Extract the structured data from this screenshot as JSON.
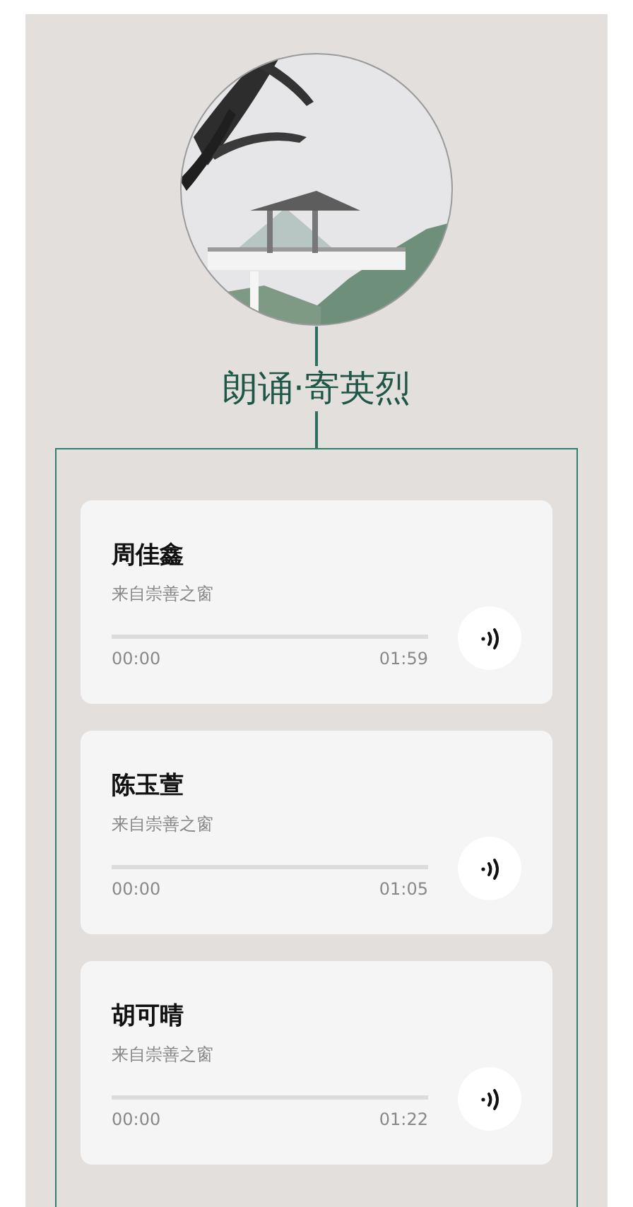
{
  "title": "朗诵·寄英烈",
  "recordings": [
    {
      "name": "周佳鑫",
      "source": "来自崇善之窗",
      "level": 0,
      "current": "00:00",
      "duration": "01:59"
    },
    {
      "name": "陈玉萱",
      "source": "来自崇善之窗",
      "level": 0,
      "current": "00:00",
      "duration": "01:05"
    },
    {
      "name": "胡可晴",
      "source": "来自崇善之窗",
      "level": 0,
      "current": "00:00",
      "duration": "01:22"
    }
  ]
}
